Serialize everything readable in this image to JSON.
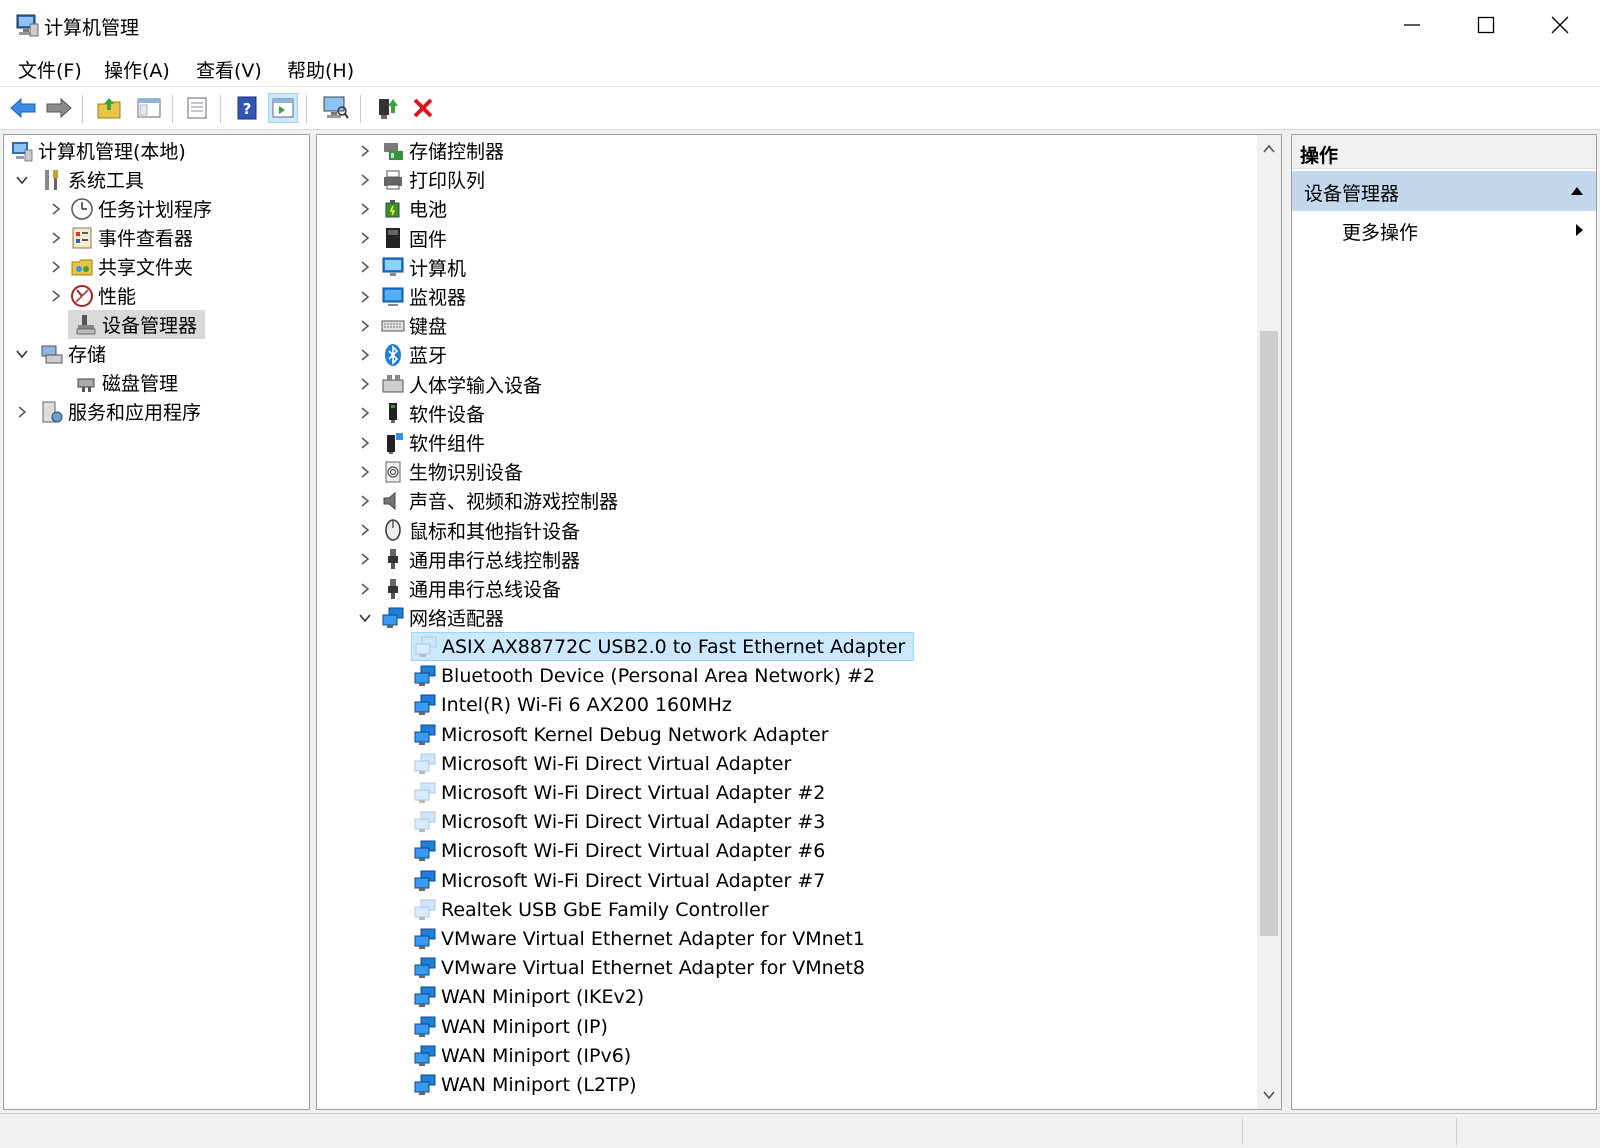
{
  "window": {
    "title": "计算机管理"
  },
  "menu": [
    "文件(F)",
    "操作(A)",
    "查看(V)",
    "帮助(H)"
  ],
  "tree": {
    "root": "计算机管理(本地)",
    "system_tools": "系统工具",
    "task_scheduler": "任务计划程序",
    "event_viewer": "事件查看器",
    "shared_folders": "共享文件夹",
    "performance": "性能",
    "device_manager": "设备管理器",
    "storage": "存储",
    "disk_management": "磁盘管理",
    "services_apps": "服务和应用程序"
  },
  "devices": {
    "categories": [
      "存储控制器",
      "打印队列",
      "电池",
      "固件",
      "计算机",
      "监视器",
      "键盘",
      "蓝牙",
      "人体学输入设备",
      "软件设备",
      "软件组件",
      "生物识别设备",
      "声音、视频和游戏控制器",
      "鼠标和其他指针设备",
      "通用串行总线控制器",
      "通用串行总线设备"
    ],
    "network_category": "网络适配器",
    "network_adapters": [
      "ASIX AX88772C USB2.0 to Fast Ethernet Adapter",
      "Bluetooth Device (Personal Area Network) #2",
      "Intel(R) Wi-Fi 6 AX200 160MHz",
      "Microsoft Kernel Debug Network Adapter",
      "Microsoft Wi-Fi Direct Virtual Adapter",
      "Microsoft Wi-Fi Direct Virtual Adapter #2",
      "Microsoft Wi-Fi Direct Virtual Adapter #3",
      "Microsoft Wi-Fi Direct Virtual Adapter #6",
      "Microsoft Wi-Fi Direct Virtual Adapter #7",
      "Realtek USB GbE Family Controller",
      "VMware Virtual Ethernet Adapter for VMnet1",
      "VMware Virtual Ethernet Adapter for VMnet8",
      "WAN Miniport (IKEv2)",
      "WAN Miniport (IP)",
      "WAN Miniport (IPv6)",
      "WAN Miniport (L2TP)"
    ]
  },
  "actions": {
    "header": "操作",
    "section": "设备管理器",
    "more": "更多操作"
  },
  "colors": {
    "selection": "#cce8ff",
    "actions_section": "#c3d8ec"
  }
}
